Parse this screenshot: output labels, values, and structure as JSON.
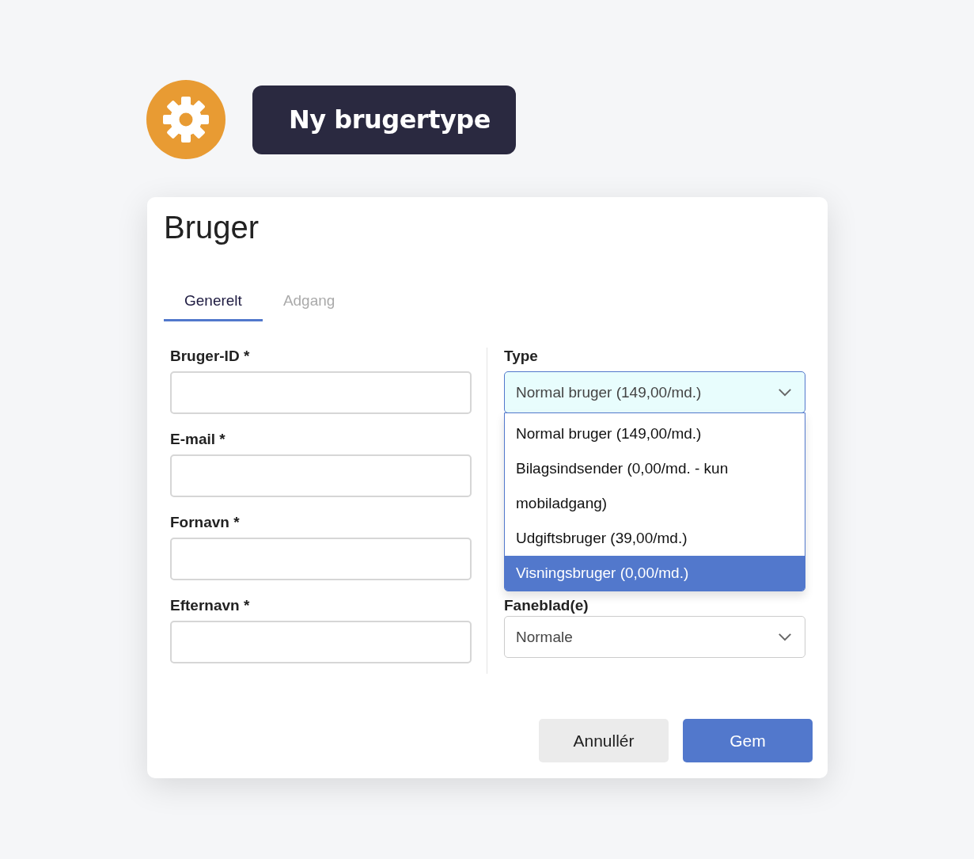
{
  "header": {
    "title": "Ny brugertype"
  },
  "card": {
    "title": "Bruger",
    "tabs": [
      {
        "label": "Generelt",
        "selected": true
      },
      {
        "label": "Adgang",
        "selected": false
      }
    ],
    "left_fields": [
      {
        "label": "Bruger-ID *"
      },
      {
        "label": "E-mail *"
      },
      {
        "label": "Fornavn *"
      },
      {
        "label": "Efternavn *"
      }
    ],
    "type_select": {
      "label": "Type",
      "value": "Normal bruger (149,00/md.)",
      "expanded": true,
      "options": [
        {
          "label": "Normal bruger (149,00/md.)",
          "highlighted": false
        },
        {
          "label": "Bilagsindsender (0,00/md. - kun mobiladgang)",
          "highlighted": false
        },
        {
          "label": "Udgiftsbruger (39,00/md.)",
          "highlighted": false
        },
        {
          "label": "Visningsbruger (0,00/md.)",
          "highlighted": true
        }
      ]
    },
    "tab_select": {
      "label": "Faneblad(e)",
      "value": "Normale"
    },
    "buttons": [
      {
        "label": "Annullér",
        "kind": "secondary"
      },
      {
        "label": "Gem",
        "kind": "primary"
      }
    ]
  }
}
